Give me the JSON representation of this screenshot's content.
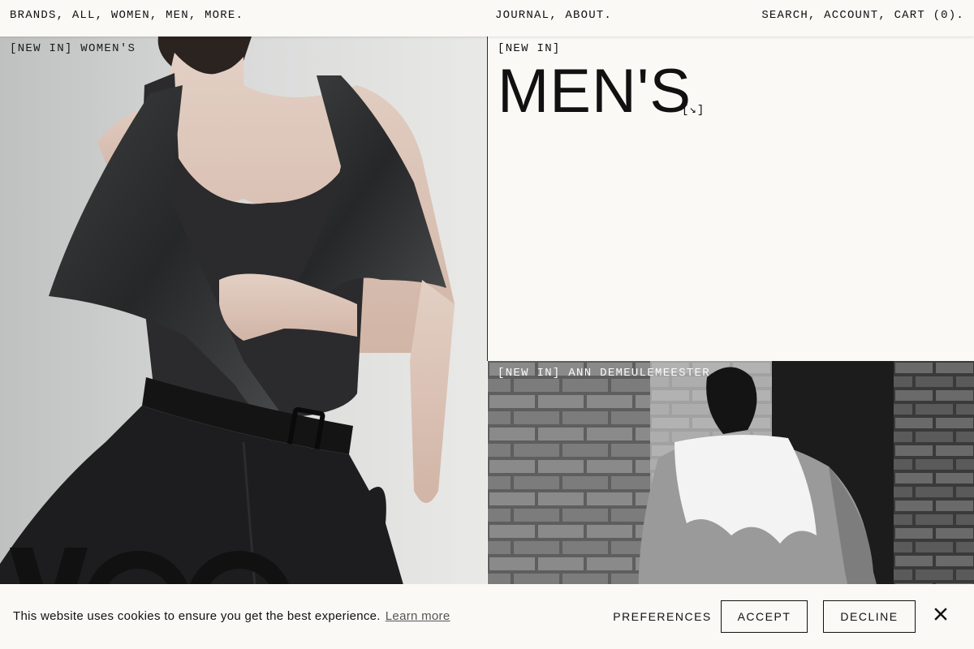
{
  "nav": {
    "left": [
      "BRANDS,",
      "ALL,",
      "WOMEN,",
      "MEN,",
      "MORE."
    ],
    "center": [
      "JOURNAL,",
      "ABOUT."
    ],
    "right": [
      "SEARCH,",
      "ACCOUNT,",
      "CART (0)."
    ]
  },
  "panels": {
    "womens": {
      "label": "[NEW IN] WOMEN'S"
    },
    "mens": {
      "label": "[NEW IN]",
      "title": "MEN'S",
      "arrow": "[↘]"
    },
    "ann": {
      "label": "[NEW IN] ANN DEMEULEMEESTER"
    }
  },
  "cookie": {
    "text": "This website uses cookies to ensure you get the best experience.",
    "learn_more": "Learn more",
    "preferences": "PREFERENCES",
    "accept": "ACCEPT",
    "decline": "DECLINE",
    "close_icon": "close-icon"
  }
}
